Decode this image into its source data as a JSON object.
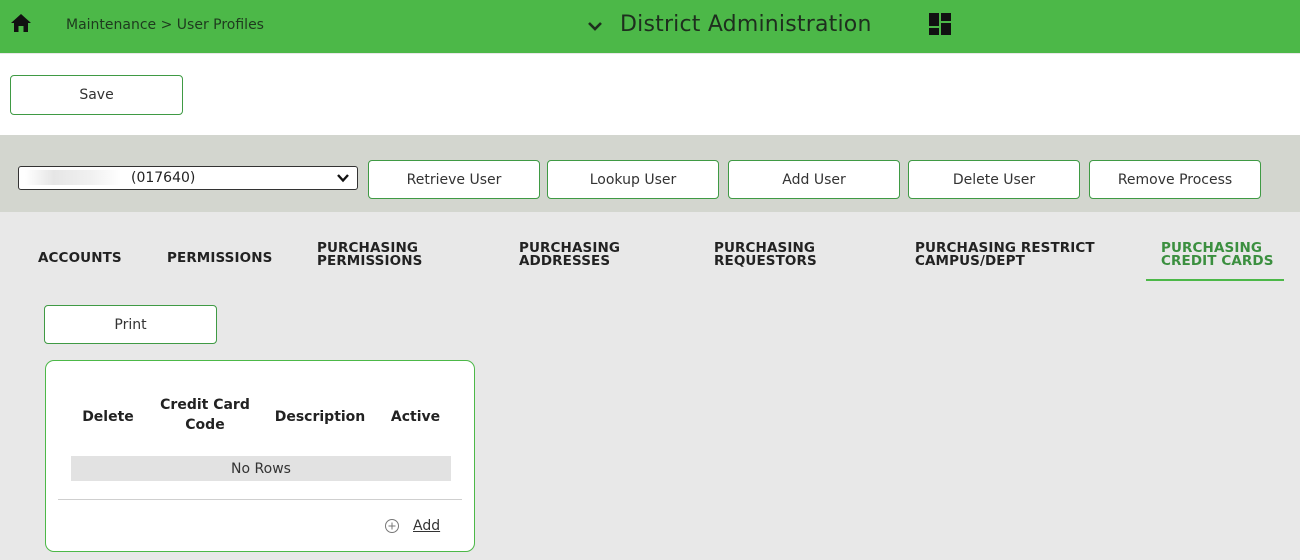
{
  "header": {
    "home_icon": "home-icon",
    "breadcrumb": "Maintenance > User Profiles",
    "dropdown_icon": "chevron-down-icon",
    "app_title": "District Administration",
    "grid_icon": "dashboard-grid-icon",
    "bar_color": "#4cb848"
  },
  "toolbar": {
    "save_label": "Save"
  },
  "user_bar": {
    "selected_user_id": "(017640)",
    "buttons": {
      "retrieve": "Retrieve User",
      "lookup": "Lookup User",
      "add": "Add User",
      "delete": "Delete User",
      "remove_process": "Remove Process"
    }
  },
  "tabs": [
    {
      "line1": "ACCOUNTS",
      "line2": ""
    },
    {
      "line1": "PERMISSIONS",
      "line2": ""
    },
    {
      "line1": "PURCHASING",
      "line2": "PERMISSIONS"
    },
    {
      "line1": "PURCHASING",
      "line2": "ADDRESSES"
    },
    {
      "line1": "PURCHASING",
      "line2": "REQUESTORS"
    },
    {
      "line1": "PURCHASING RESTRICT",
      "line2": "CAMPUS/DEPT"
    },
    {
      "line1": "PURCHASING",
      "line2": "CREDIT CARDS",
      "active": true
    }
  ],
  "content": {
    "print_label": "Print",
    "table": {
      "columns": [
        {
          "line1": "Delete",
          "line2": ""
        },
        {
          "line1": "Credit Card",
          "line2": "Code"
        },
        {
          "line1": "Description",
          "line2": ""
        },
        {
          "line1": "Active",
          "line2": ""
        }
      ],
      "empty_text": "No Rows"
    },
    "add_icon": "plus-circle-icon",
    "add_label": "Add"
  }
}
